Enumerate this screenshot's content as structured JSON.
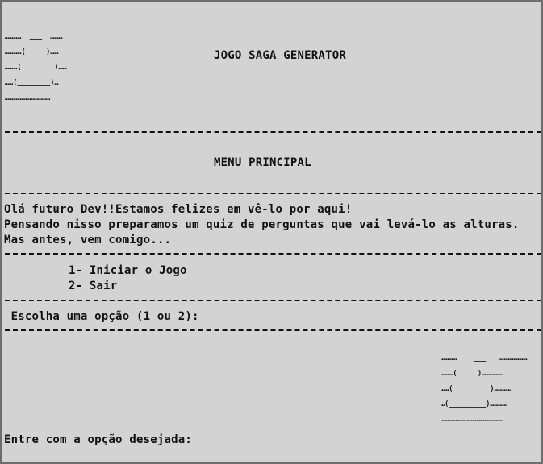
{
  "logo_left": [
    "…………  ___  ………",
    "…………(     )……",
    "………(        )……",
    "……(________)…",
    "……………………………"
  ],
  "title": "JOGO SAGA GENERATOR",
  "menu_title": "MENU PRINCIPAL",
  "intro": [
    "Olá futuro Dev!!Estamos felizes em vê-lo por aqui!",
    "Pensando nisso preparamos um quiz de perguntas que vai levá-lo as alturas.",
    "Mas antes, vem comigo..."
  ],
  "options": [
    "1- Iniciar o Jogo",
    "2- Sair"
  ],
  "choose_prompt": " Escolha uma opção (1 ou 2):",
  "logo_right": [
    "…………    ___   …………………",
    "………(     )……………",
    "……(         )…………",
    "…(_________)…………",
    "………………………………………"
  ],
  "input_prompt": "Entre com a opção desejada:"
}
